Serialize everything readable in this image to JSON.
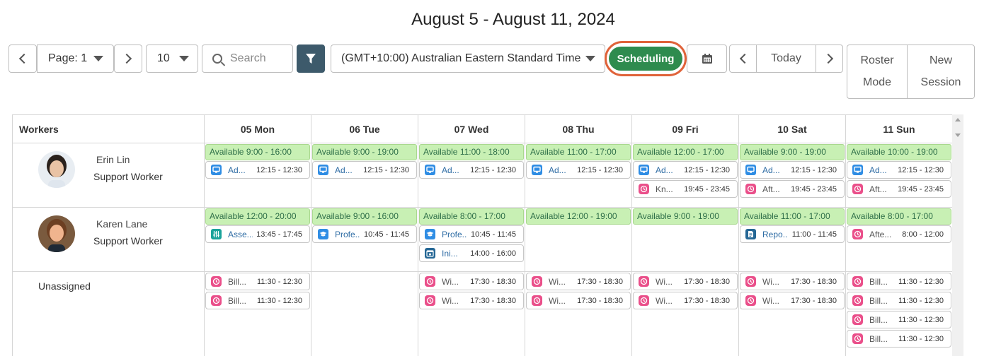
{
  "header": {
    "title": "August 5 - August 11, 2024"
  },
  "toolbar": {
    "page_label": "Page: 1",
    "page_size": "10",
    "search_placeholder": "Search",
    "timezone": "(GMT+10:00) Australian Eastern Standard Time",
    "scheduling_label": "Scheduling",
    "today_label": "Today",
    "roster_label_1": "Roster",
    "roster_label_2": "Mode",
    "new_label_1": "New",
    "new_label_2": "Session"
  },
  "grid": {
    "workers_header": "Workers",
    "days": [
      "05 Mon",
      "06 Tue",
      "07 Wed",
      "08 Thu",
      "09 Fri",
      "10 Sat",
      "11 Sun"
    ],
    "rows": [
      {
        "name": "Erin Lin",
        "role": "Support Worker",
        "cells": [
          {
            "avail": "Available 9:00 - 16:00",
            "sessions": [
              {
                "icon": "monitor-icon",
                "color": "blue",
                "name": "Ad...",
                "time": "12:15 - 12:30"
              }
            ]
          },
          {
            "avail": "Available 9:00 - 19:00",
            "sessions": [
              {
                "icon": "monitor-icon",
                "color": "blue",
                "name": "Ad...",
                "time": "12:15 - 12:30"
              }
            ]
          },
          {
            "avail": "Available 11:00 - 18:00",
            "sessions": [
              {
                "icon": "monitor-icon",
                "color": "blue",
                "name": "Ad...",
                "time": "12:15 - 12:30"
              }
            ]
          },
          {
            "avail": "Available 11:00 - 17:00",
            "sessions": [
              {
                "icon": "monitor-icon",
                "color": "blue",
                "name": "Ad...",
                "time": "12:15 - 12:30"
              }
            ]
          },
          {
            "avail": "Available 12:00 - 17:00",
            "sessions": [
              {
                "icon": "monitor-icon",
                "color": "blue",
                "name": "Ad...",
                "time": "12:15 - 12:30"
              },
              {
                "icon": "clock-icon",
                "color": "pink",
                "name": "Kn...",
                "time": "19:45 - 23:45"
              }
            ]
          },
          {
            "avail": "Available 9:00 - 19:00",
            "sessions": [
              {
                "icon": "monitor-icon",
                "color": "blue",
                "name": "Ad...",
                "time": "12:15 - 12:30"
              },
              {
                "icon": "clock-icon",
                "color": "pink",
                "name": "Aft...",
                "time": "19:45 - 23:45"
              }
            ]
          },
          {
            "avail": "Available 10:00 - 19:00",
            "sessions": [
              {
                "icon": "monitor-icon",
                "color": "blue",
                "name": "Ad...",
                "time": "12:15 - 12:30"
              },
              {
                "icon": "clock-icon",
                "color": "pink",
                "name": "Aft...",
                "time": "19:45 - 23:45"
              }
            ]
          }
        ]
      },
      {
        "name": "Karen Lane",
        "role": "Support Worker",
        "cells": [
          {
            "avail": "Available 12:00 - 20:00",
            "sessions": [
              {
                "icon": "sliders-icon",
                "color": "teal",
                "name": "Asse...",
                "time": "13:45 - 17:45"
              }
            ]
          },
          {
            "avail": "Available 9:00 - 16:00",
            "sessions": [
              {
                "icon": "graduation-cap-icon",
                "color": "blue",
                "name": "Profe...",
                "time": "10:45 - 11:45"
              }
            ]
          },
          {
            "avail": "Available 8:00 - 17:00",
            "sessions": [
              {
                "icon": "graduation-cap-icon",
                "color": "blue",
                "name": "Profe...",
                "time": "10:45 - 11:45"
              },
              {
                "icon": "calendar-icon",
                "color": "navy",
                "name": "Ini...",
                "time": "14:00 - 16:00"
              }
            ]
          },
          {
            "avail": "Available 12:00 - 19:00",
            "sessions": []
          },
          {
            "avail": "Available 9:00 - 19:00",
            "sessions": []
          },
          {
            "avail": "Available 11:00 - 17:00",
            "sessions": [
              {
                "icon": "report-icon",
                "color": "navy",
                "name": "Repo...",
                "time": "11:00 - 11:45"
              }
            ]
          },
          {
            "avail": "Available 8:00 - 17:00",
            "sessions": [
              {
                "icon": "clock-icon",
                "color": "pink",
                "name": "Afte...",
                "time": "8:00 - 12:00"
              }
            ]
          }
        ]
      },
      {
        "name": "Unassigned",
        "cells": [
          {
            "sessions": [
              {
                "icon": "clock-icon",
                "color": "pink",
                "name": "Bill...",
                "time": "11:30 - 12:30"
              },
              {
                "icon": "clock-icon",
                "color": "pink",
                "name": "Bill...",
                "time": "11:30 - 12:30"
              }
            ]
          },
          {
            "sessions": []
          },
          {
            "sessions": [
              {
                "icon": "clock-icon",
                "color": "pink",
                "name": "Wi...",
                "time": "17:30 - 18:30"
              },
              {
                "icon": "clock-icon",
                "color": "pink",
                "name": "Wi...",
                "time": "17:30 - 18:30"
              }
            ]
          },
          {
            "sessions": [
              {
                "icon": "clock-icon",
                "color": "pink",
                "name": "Wi...",
                "time": "17:30 - 18:30"
              },
              {
                "icon": "clock-icon",
                "color": "pink",
                "name": "Wi...",
                "time": "17:30 - 18:30"
              }
            ]
          },
          {
            "sessions": [
              {
                "icon": "clock-icon",
                "color": "pink",
                "name": "Wi...",
                "time": "17:30 - 18:30"
              },
              {
                "icon": "clock-icon",
                "color": "pink",
                "name": "Wi...",
                "time": "17:30 - 18:30"
              }
            ]
          },
          {
            "sessions": [
              {
                "icon": "clock-icon",
                "color": "pink",
                "name": "Wi...",
                "time": "17:30 - 18:30"
              },
              {
                "icon": "clock-icon",
                "color": "pink",
                "name": "Wi...",
                "time": "17:30 - 18:30"
              }
            ]
          },
          {
            "sessions": [
              {
                "icon": "clock-icon",
                "color": "pink",
                "name": "Bill...",
                "time": "11:30 - 12:30"
              },
              {
                "icon": "clock-icon",
                "color": "pink",
                "name": "Bill...",
                "time": "11:30 - 12:30"
              },
              {
                "icon": "clock-icon",
                "color": "pink",
                "name": "Bill...",
                "time": "11:30 - 12:30"
              },
              {
                "icon": "clock-icon",
                "color": "pink",
                "name": "Bill...",
                "time": "11:30 - 12:30"
              }
            ]
          }
        ]
      }
    ]
  },
  "colors": {
    "accent": "#3d5a6b",
    "scheduling": "#2e8b4e",
    "highlight_ring": "#e0633a",
    "available_bg": "#c8f0b4",
    "session_blue": "#2f8de4",
    "session_pink": "#ea4f8a"
  }
}
